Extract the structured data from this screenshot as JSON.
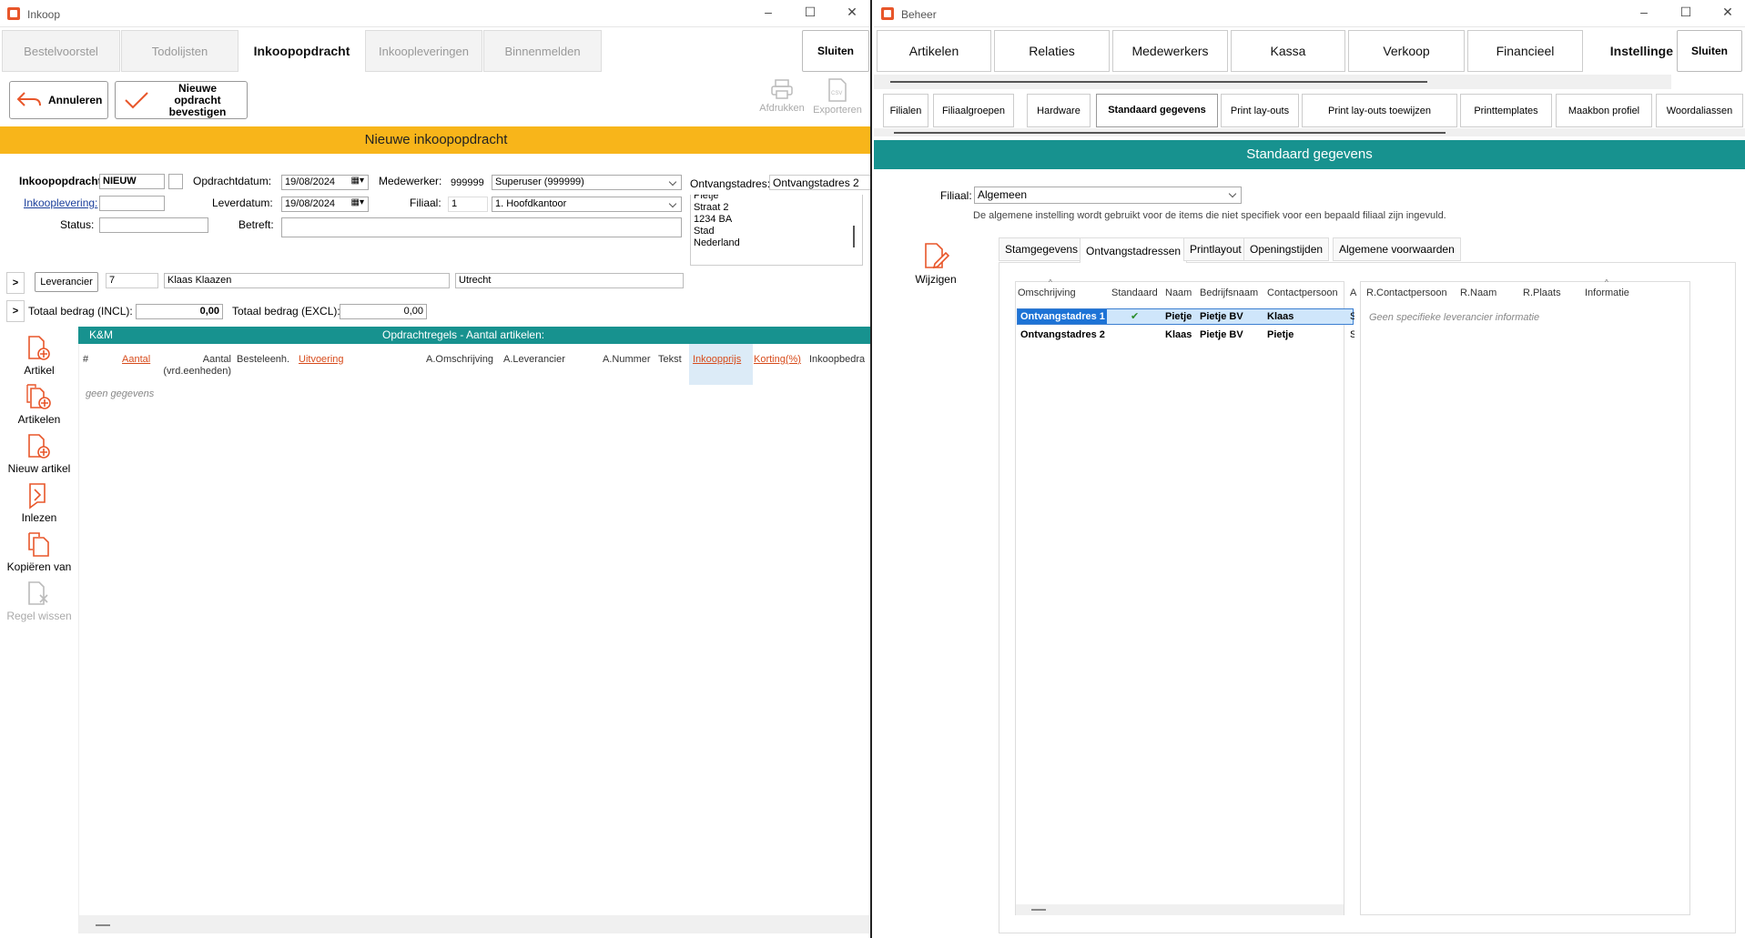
{
  "left": {
    "title": "Inkoop",
    "tabs": [
      "Bestelvoorstel",
      "Todolijsten",
      "Inkoopopdracht",
      "Inkoopleveringen",
      "Binnenmelden"
    ],
    "close": "Sluiten",
    "cancel": "Annuleren",
    "confirm": "Nieuwe opdracht bevestigen",
    "print": "Afdrukken",
    "export": "Exporteren",
    "banner": "Nieuwe inkoopopdracht",
    "form": {
      "order_label": "Inkoopopdracht:",
      "order_value": "NIEUW",
      "delivery_link": "Inkooplevering:",
      "status_label": "Status:",
      "orderdate_label": "Opdrachtdatum:",
      "orderdate": "19/08/2024",
      "deliverdate_label": "Leverdatum:",
      "deliverdate": "19/08/2024",
      "subject_label": "Betreft:",
      "employee_label": "Medewerker:",
      "employee_code": "999999",
      "employee_name": "Superuser (999999)",
      "branch_label": "Filiaal:",
      "branch_code": "1",
      "branch_name": "1. Hoofdkantoor",
      "address_label": "Ontvangstadres:",
      "address_value": "Ontvangstadres 2",
      "address_lines": [
        "Pietje",
        "Straat 2",
        "1234 BA",
        "Stad",
        "Nederland"
      ],
      "expand": ">",
      "supplier_btn": "Leverancier",
      "supplier_code": "7",
      "supplier_name": "Klaas Klaazen",
      "supplier_city": "Utrecht",
      "total_incl_label": "Totaal bedrag (INCL):",
      "total_incl": "0,00",
      "total_excl_label": "Totaal bedrag (EXCL):",
      "total_excl": "0,00"
    },
    "grid": {
      "group": "K&M",
      "title": "Opdrachtregels - Aantal artikelen:",
      "columns": [
        "#",
        "Aantal",
        "Aantal (vrd.eenheden)",
        "Besteleenh.",
        "Uitvoering",
        "A.Omschrijving",
        "A.Leverancier",
        "A.Nummer",
        "Tekst",
        "Inkoopprijs",
        "Korting(%)",
        "Inkoopbedra"
      ],
      "empty": "geen gegevens"
    },
    "side": [
      "Artikel",
      "Artikelen",
      "Nieuw artikel",
      "Inlezen",
      "Kopiëren van",
      "Regel wissen"
    ]
  },
  "right": {
    "title": "Beheer",
    "tabs": [
      "Artikelen",
      "Relaties",
      "Medewerkers",
      "Kassa",
      "Verkoop",
      "Financieel",
      "Instellinge"
    ],
    "close": "Sluiten",
    "subtabs": [
      "Filialen",
      "Filiaalgroepen",
      "Hardware",
      "Standaard gegevens",
      "Print lay-outs",
      "Print lay-outs toewijzen",
      "Printtemplates",
      "Maakbon profiel",
      "Woordaliassen"
    ],
    "banner": "Standaard gegevens",
    "branch_label": "Filiaal:",
    "branch_value": "Algemeen",
    "note": "De algemene instelling wordt gebruikt voor de items die niet specifiek voor een bepaald filiaal zijn ingevuld.",
    "edit": "Wijzigen",
    "innertabs": [
      "Stamgegevens",
      "Ontvangstadressen",
      "Printlayout",
      "Openingstijden",
      "Algemene voorwaarden"
    ],
    "grid1": {
      "columns": [
        "Omschrijving",
        "Standaard",
        "Naam",
        "Bedrijfsnaam",
        "Contactpersoon",
        "A"
      ],
      "rows": [
        {
          "omschrijving": "Ontvangstadres 1",
          "standaard": "✔",
          "naam": "Pietje",
          "bedrijf": "Pietje BV",
          "contact": "Klaas",
          "extra": "S"
        },
        {
          "omschrijving": "Ontvangstadres 2",
          "standaard": "",
          "naam": "Klaas",
          "bedrijf": "Pietje BV",
          "contact": "Pietje",
          "extra": "S"
        }
      ]
    },
    "grid2": {
      "columns": [
        "R.Contactpersoon",
        "R.Naam",
        "R.Plaats",
        "Informatie"
      ],
      "empty": "Geen specifieke leverancier informatie"
    }
  }
}
